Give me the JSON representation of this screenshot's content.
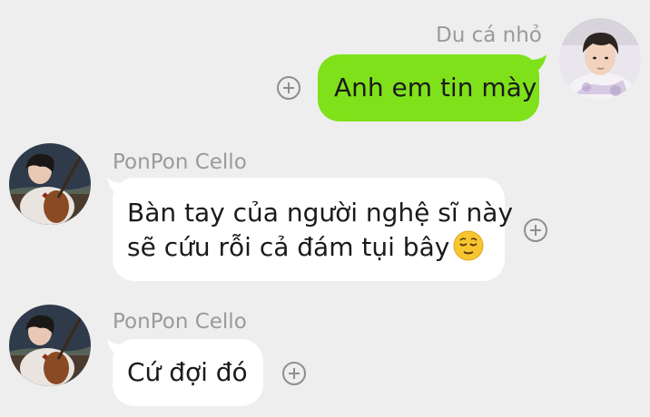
{
  "theme": {
    "background": "#eeeeee",
    "outgoing_bubble": "#7fe11a",
    "incoming_bubble": "#ffffff",
    "name_color": "#9a9a9a"
  },
  "messages": [
    {
      "direction": "outgoing",
      "sender": "Du cá nhỏ",
      "text": "Anh em tin mày",
      "avatar": "avatar-du-ca-nho"
    },
    {
      "direction": "incoming",
      "sender": "PonPon Cello",
      "lines": [
        "Bàn tay của người nghệ sĩ này",
        "sẽ cứu rỗi cả đám tụi bây"
      ],
      "emoji": "relieved-face-emoji",
      "avatar": "avatar-ponpon-cello"
    },
    {
      "direction": "incoming",
      "sender": "PonPon Cello",
      "text": "Cứ đợi đó",
      "avatar": "avatar-ponpon-cello"
    }
  ]
}
